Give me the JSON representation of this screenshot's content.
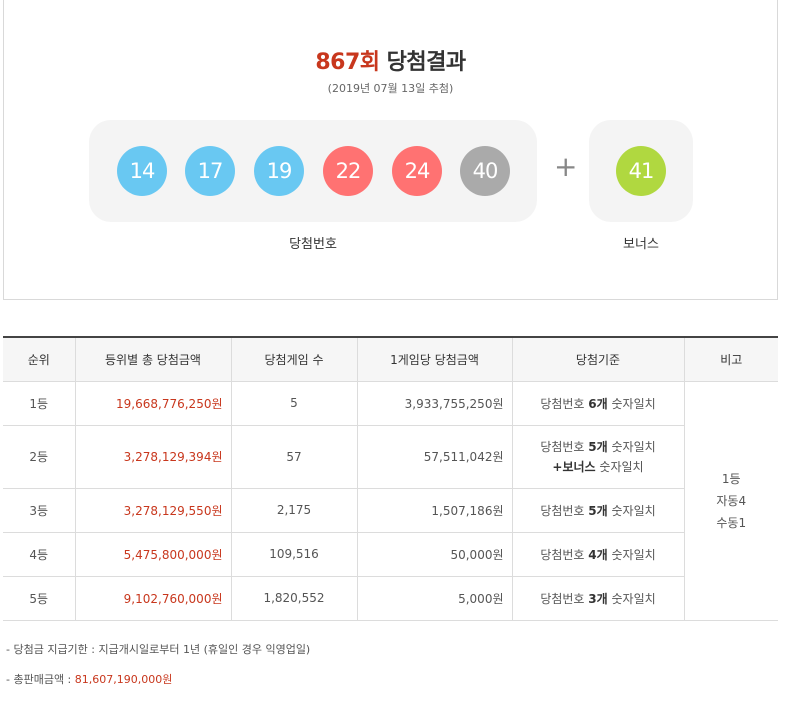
{
  "header": {
    "round": "867회",
    "title_suffix": " 당첨결과",
    "draw_date": "(2019년 07월 13일 추첨)"
  },
  "winning": {
    "numbers": [
      "14",
      "17",
      "19",
      "22",
      "24",
      "40"
    ],
    "plus": "+",
    "bonus": "41",
    "caption_numbers": "당첨번호",
    "caption_bonus": "보너스"
  },
  "colors": {
    "ball_blue": "#69c8f2",
    "ball_red": "#ff7272",
    "ball_gray": "#aaaaaa",
    "ball_green": "#b0d840",
    "accent_red": "#c8371d"
  },
  "table": {
    "headers": [
      "순위",
      "등위별 총 당첨금액",
      "당첨게임 수",
      "1게임당 당첨금액",
      "당첨기준",
      "비고"
    ],
    "rows": [
      {
        "rank": "1등",
        "total": "19,668,776,250원",
        "games": "5",
        "per_game": "3,933,755,250원",
        "crit_pre": "당첨번호 ",
        "crit_bold": "6개",
        "crit_post": " 숫자일치",
        "crit2_bold": "",
        "crit2_post": ""
      },
      {
        "rank": "2등",
        "total": "3,278,129,394원",
        "games": "57",
        "per_game": "57,511,042원",
        "crit_pre": "당첨번호 ",
        "crit_bold": "5개",
        "crit_post": " 숫자일치",
        "crit2_bold": "+보너스",
        "crit2_post": " 숫자일치"
      },
      {
        "rank": "3등",
        "total": "3,278,129,550원",
        "games": "2,175",
        "per_game": "1,507,186원",
        "crit_pre": "당첨번호 ",
        "crit_bold": "5개",
        "crit_post": " 숫자일치",
        "crit2_bold": "",
        "crit2_post": ""
      },
      {
        "rank": "4등",
        "total": "5,475,800,000원",
        "games": "109,516",
        "per_game": "50,000원",
        "crit_pre": "당첨번호 ",
        "crit_bold": "4개",
        "crit_post": " 숫자일치",
        "crit2_bold": "",
        "crit2_post": ""
      },
      {
        "rank": "5등",
        "total": "9,102,760,000원",
        "games": "1,820,552",
        "per_game": "5,000원",
        "crit_pre": "당첨번호 ",
        "crit_bold": "3개",
        "crit_post": " 숫자일치",
        "crit2_bold": "",
        "crit2_post": ""
      }
    ],
    "note": [
      "1등",
      "자동4",
      "수동1"
    ]
  },
  "notes": {
    "deadline": "-  당첨금 지급기한 : 지급개시일로부터 1년 (휴일인 경우 익영업일)",
    "sales_label": "-  총판매금액 : ",
    "sales_value": "81,607,190,000원"
  }
}
